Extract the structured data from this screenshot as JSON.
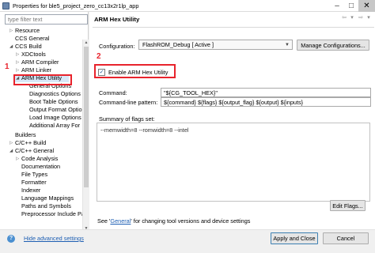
{
  "window": {
    "title": "Properties for ble5_project_zero_cc13x2r1lp_app",
    "min_glyph": "–",
    "max_glyph": "□",
    "close_glyph": "✕"
  },
  "filter": {
    "placeholder": "type filter text"
  },
  "tree": [
    {
      "label": "Resource",
      "arrow": "▷"
    },
    {
      "label": "CCS General",
      "arrow": ""
    },
    {
      "label": "CCS Build",
      "arrow": "◢"
    },
    {
      "label": "XDCtools",
      "arrow": "▷"
    },
    {
      "label": "ARM Compiler",
      "arrow": "▷"
    },
    {
      "label": "ARM Linker",
      "arrow": "▷"
    },
    {
      "label": "ARM Hex Utility",
      "arrow": "◢"
    },
    {
      "label": "General Options",
      "arrow": ""
    },
    {
      "label": "Diagnostics Options",
      "arrow": ""
    },
    {
      "label": "Boot Table Options",
      "arrow": ""
    },
    {
      "label": "Output Format Options",
      "arrow": ""
    },
    {
      "label": "Load Image Options",
      "arrow": ""
    },
    {
      "label": "Additional Array For",
      "arrow": ""
    },
    {
      "label": "Builders",
      "arrow": ""
    },
    {
      "label": "C/C++ Build",
      "arrow": "▷"
    },
    {
      "label": "C/C++ General",
      "arrow": "◢"
    },
    {
      "label": "Code Analysis",
      "arrow": "▷"
    },
    {
      "label": "Documentation",
      "arrow": ""
    },
    {
      "label": "File Types",
      "arrow": ""
    },
    {
      "label": "Formatter",
      "arrow": ""
    },
    {
      "label": "Indexer",
      "arrow": ""
    },
    {
      "label": "Language Mappings",
      "arrow": ""
    },
    {
      "label": "Paths and Symbols",
      "arrow": ""
    },
    {
      "label": "Preprocessor Include Pa",
      "arrow": ""
    }
  ],
  "page": {
    "title": "ARM Hex Utility",
    "configuration_label": "Configuration:",
    "configuration_value": "FlashROM_Debug  [ Active ]",
    "manage_button": "Manage Configurations...",
    "enable_checkbox_label": "Enable ARM Hex Utility",
    "enable_checked": true,
    "check_glyph": "✓",
    "command_label": "Command:",
    "command_value": "\"${CG_TOOL_HEX}\"",
    "pattern_label": "Command-line pattern:",
    "pattern_value": "${command} ${flags} ${output_flag} ${output} ${inputs}",
    "summary_label": "Summary of flags set:",
    "summary_value": "--memwidth=8 --romwidth=8 --intel",
    "edit_flags_button": "Edit Flags...",
    "see_prefix": "See '",
    "see_link": "General",
    "see_suffix": "' for changing tool versions and device settings"
  },
  "bottom": {
    "help_glyph": "?",
    "hide_advanced": "Hide advanced settings",
    "apply_close": "Apply and Close",
    "cancel": "Cancel"
  },
  "annotations": {
    "marker1": "1",
    "marker2": "2",
    "accent": "#e8232c"
  }
}
